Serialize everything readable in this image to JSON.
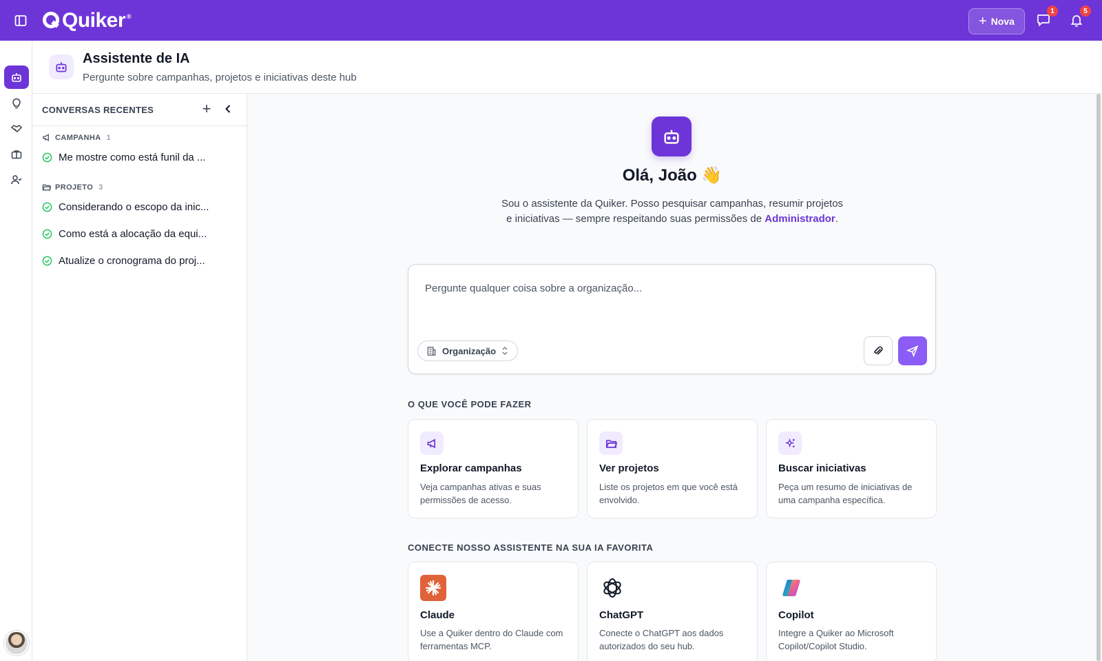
{
  "app": {
    "brand": "Quiker",
    "brand_mark": "®",
    "new_button_label": "Nova",
    "messages_badge": "1",
    "notifications_badge": "5"
  },
  "header": {
    "title": "Assistente de IA",
    "subtitle": "Pergunte sobre campanhas, projetos e iniciativas deste hub"
  },
  "conversations": {
    "title": "CONVERSAS RECENTES",
    "groups": [
      {
        "label": "CAMPANHA",
        "count": "1",
        "items": [
          "Me mostre como está funil da ..."
        ]
      },
      {
        "label": "PROJETO",
        "count": "3",
        "items": [
          "Considerando o escopo da inic...",
          "Como está a alocação da equi...",
          "Atualize o cronograma do proj..."
        ]
      }
    ]
  },
  "hero": {
    "greeting": "Olá, João 👋",
    "intro_text": "Sou o assistente da Quiker. Posso pesquisar campanhas, resumir projetos e iniciativas — sempre respeitando suas permissões de",
    "permission_role": "Administrador",
    "intro_end": "."
  },
  "prompt": {
    "placeholder": "Pergunte qualquer coisa sobre a organização...",
    "scope_value": "Organização"
  },
  "actions": {
    "title": "O QUE VOCÊ PODE FAZER",
    "cards": [
      {
        "title": "Explorar campanhas",
        "desc": "Veja campanhas ativas e suas permissões de acesso.",
        "icon": "megaphone-icon"
      },
      {
        "title": "Ver projetos",
        "desc": "Liste os projetos em que você está envolvido.",
        "icon": "folder-open-icon"
      },
      {
        "title": "Buscar iniciativas",
        "desc": "Peça um resumo de iniciativas de uma campanha específica.",
        "icon": "sparkles-icon"
      }
    ]
  },
  "integrations": {
    "title": "CONECTE NOSSO ASSISTENTE NA SUA IA FAVORITA",
    "cards": [
      {
        "title": "Claude",
        "desc": "Use a Quiker dentro do Claude com ferramentas MCP.",
        "icon": "claude-logo"
      },
      {
        "title": "ChatGPT",
        "desc": "Conecte o ChatGPT aos dados autorizados do seu hub.",
        "icon": "chatgpt-logo"
      },
      {
        "title": "Copilot",
        "desc": "Integre a Quiker ao Microsoft Copilot/Copilot Studio.",
        "icon": "copilot-logo"
      }
    ]
  },
  "colors": {
    "brand": "#6d35d8",
    "brand_light": "#f1ebff",
    "success": "#22c55e",
    "badge": "#ef4444"
  }
}
